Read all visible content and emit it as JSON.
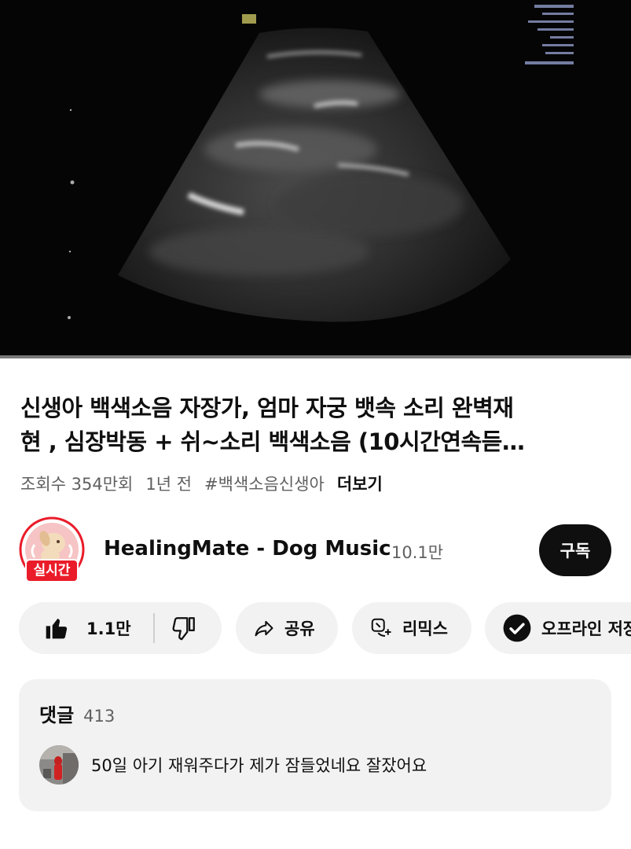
{
  "video": {
    "progress_fraction": 0.0,
    "overlay_text": "MFI 0.0 Dist"
  },
  "title": {
    "line1": "신생아 백색소음 자장가, 엄마 자궁 뱃속 소리  완벽재",
    "line2": "현 , 심장박동 + 쉬~소리 백색소음 (10시간연속듣…"
  },
  "meta": {
    "views": "조회수 354만회",
    "age": "1년 전",
    "hashtag": "#백색소음신생아",
    "more": "더보기"
  },
  "channel": {
    "live_badge": "실시간",
    "name": "HealingMate - Dog Music",
    "subscribers": "10.1만",
    "subscribe_label": "구독"
  },
  "actions": {
    "like_count": "1.1만",
    "share_label": "공유",
    "remix_label": "리믹스",
    "offline_label": "오프라인 저장"
  },
  "comments": {
    "title": "댓글",
    "count": "413",
    "top_comment": "50일 아기 재워주다가 제가 잠들었네요 잘잤어요"
  },
  "colors": {
    "accent_red": "#ff0000",
    "live_red": "#ea1c2a",
    "pill_bg": "#f2f2f2"
  },
  "icons": [
    "like-icon",
    "dislike-icon",
    "share-icon",
    "remix-icon",
    "download-icon"
  ]
}
